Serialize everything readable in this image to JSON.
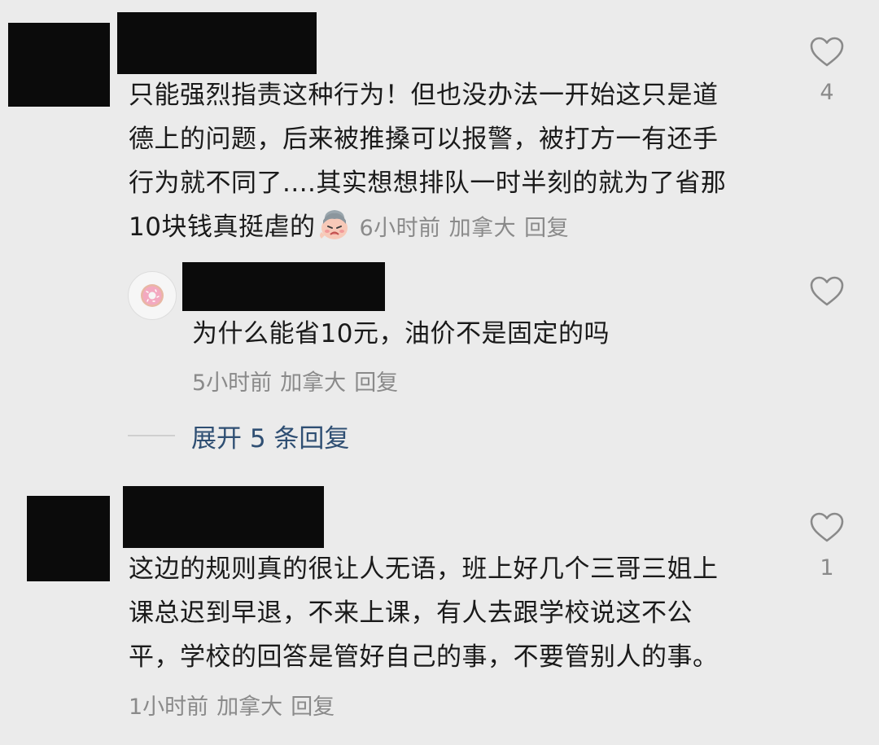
{
  "comments": [
    {
      "text_lines": [
        "只能强烈指责这种行为！但也没办法一开始这只是道",
        "德上的问题，后来被推搡可以报警，被打方一有还手",
        "行为就不同了....其实想想排队一时半刻的就为了省那",
        "10块钱真挺虐的"
      ],
      "emoji_icon": "crying-face-emoji",
      "time": "6小时前",
      "location": "加拿大",
      "reply_label": "回复",
      "like_count": "4",
      "replies": [
        {
          "avatar_icon": "donut-avatar",
          "text": "为什么能省10元，油价不是固定的吗",
          "time": "5小时前",
          "location": "加拿大",
          "reply_label": "回复"
        }
      ],
      "expand_label": "展开 5 条回复"
    },
    {
      "text_lines": [
        "这边的规则真的很让人无语，班上好几个三哥三姐上",
        "课总迟到早退，不来上课，有人去跟学校说这不公",
        "平，学校的回答是管好自己的事，不要管别人的事。"
      ],
      "time": "1小时前",
      "location": "加拿大",
      "reply_label": "回复",
      "like_count": "1"
    }
  ],
  "icons": {
    "like": "heart-outline-icon"
  },
  "colors": {
    "background": "#ebebeb",
    "text": "#1a1a1a",
    "meta": "#8a8a8a",
    "expand_link": "#2f4f73",
    "redaction": "#0b0b0b"
  }
}
